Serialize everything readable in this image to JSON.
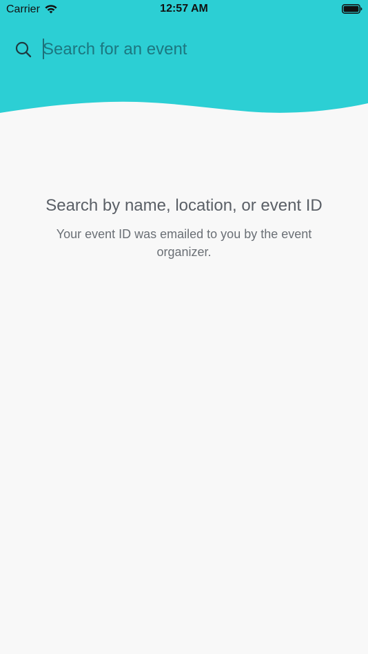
{
  "status_bar": {
    "carrier": "Carrier",
    "time": "12:57 AM",
    "wifi_icon": "wifi-icon",
    "battery_icon": "battery-icon"
  },
  "search": {
    "placeholder": "Search for an event",
    "value": "",
    "icon": "search-icon"
  },
  "empty_state": {
    "title": "Search by name, location, or event ID",
    "subtitle": "Your event ID was emailed to you by the event organizer."
  },
  "colors": {
    "header_teal": "#2ccfd4",
    "background": "#f8f8f8",
    "title_text": "#5a5f66",
    "subtitle_text": "#6a6f75"
  }
}
